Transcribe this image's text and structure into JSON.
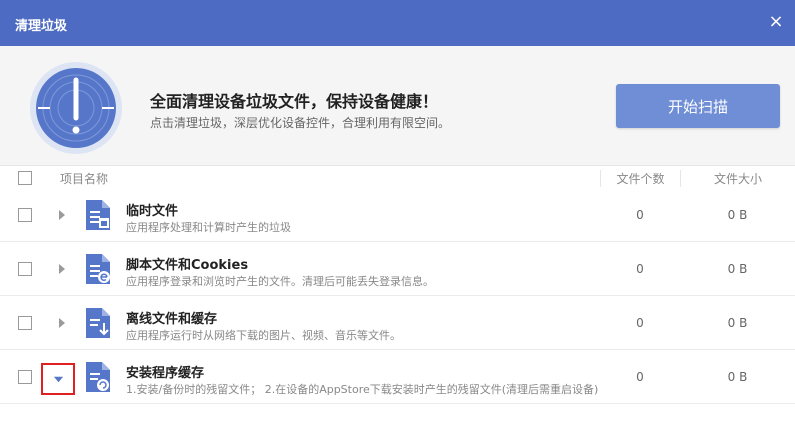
{
  "window": {
    "title": "清理垃圾",
    "close_glyph": "×"
  },
  "hero": {
    "headline": "全面清理设备垃圾文件，保持设备健康！",
    "subtitle": "点击清理垃圾，深层优化设备控件，合理利用有限空间。",
    "scan_button": "开始扫描",
    "icon": "broom-clock-icon"
  },
  "table": {
    "headers": {
      "name": "项目名称",
      "count": "文件个数",
      "size": "文件大小"
    },
    "rows": [
      {
        "name": "临时文件",
        "desc": "应用程序处理和计算时产生的垃圾",
        "count": "0",
        "size": "0 B",
        "icon": "temp-file-icon",
        "expanded": false
      },
      {
        "name": "脚本文件和Cookies",
        "desc": "应用程序登录和浏览时产生的文件。清理后可能丢失登录信息。",
        "count": "0",
        "size": "0 B",
        "icon": "script-file-icon",
        "expanded": false
      },
      {
        "name": "离线文件和缓存",
        "desc": "应用程序运行时从网络下载的图片、视频、音乐等文件。",
        "count": "0",
        "size": "0 B",
        "icon": "offline-file-icon",
        "expanded": false
      },
      {
        "name": "安装程序缓存",
        "desc": "1.安装/备份时的残留文件； 2.在设备的AppStore下载安装时产生的残留文件(清理后需重启设备)",
        "count": "0",
        "size": "0 B",
        "icon": "installer-cache-icon",
        "expanded": true
      }
    ]
  },
  "colors": {
    "titlebar": "#4e6bc3",
    "accent": "#6f8ed6",
    "highlight": "#e02020"
  }
}
